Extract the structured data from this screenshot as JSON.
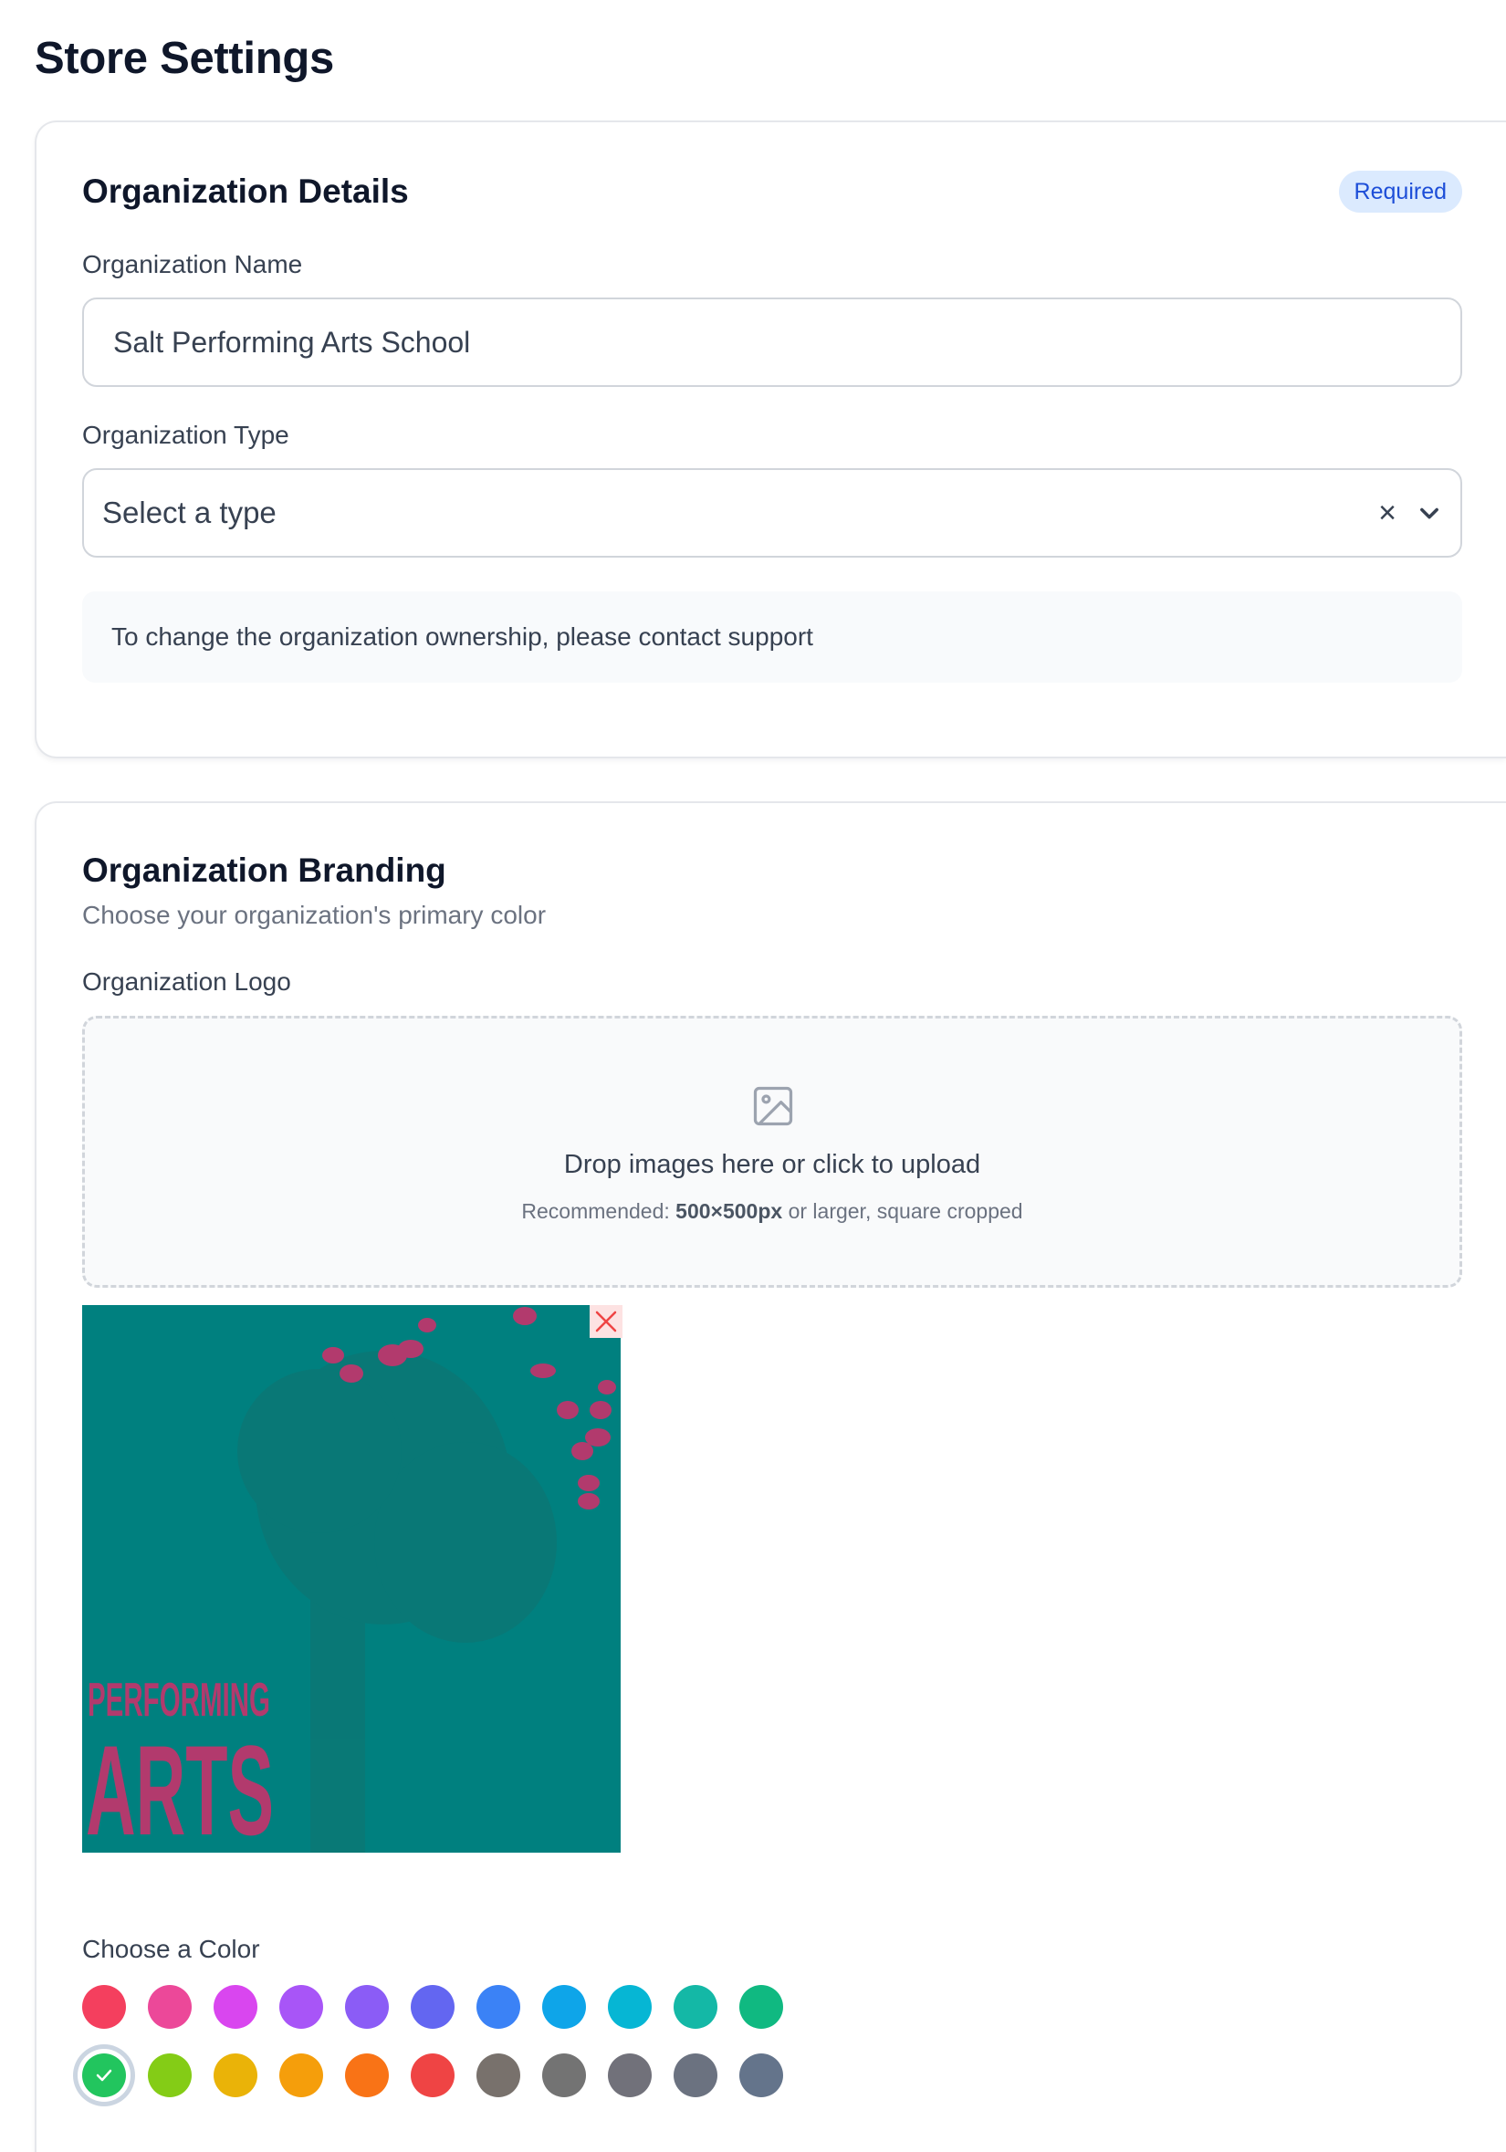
{
  "page": {
    "title": "Store Settings"
  },
  "details": {
    "title": "Organization Details",
    "badge": "Required",
    "name_label": "Organization Name",
    "name_value": "Salt Performing Arts School",
    "type_label": "Organization Type",
    "type_placeholder": "Select a type",
    "clear_glyph": "×",
    "ownership_note": "To change the organization ownership, please contact support"
  },
  "branding": {
    "title": "Organization Branding",
    "subtitle": "Choose your organization's primary color",
    "logo_label": "Organization Logo",
    "upload": {
      "main": "Drop images here or click to upload",
      "sub_prefix": "Recommended: ",
      "sub_bold": "500×500px",
      "sub_suffix": " or larger, square cropped"
    },
    "logo_image": {
      "icon": "uploaded-logo-image",
      "background": "#00807f",
      "accent": "#b23a6d",
      "text_line1": "PERFORMING",
      "text_line2": "ARTS"
    },
    "color_label": "Choose a Color",
    "colors_row1": [
      "#f43f5e",
      "#ec4899",
      "#d946ef",
      "#a855f7",
      "#8b5cf6",
      "#6366f1",
      "#3b82f6",
      "#0ea5e9",
      "#06b6d4",
      "#14b8a6",
      "#10b981"
    ],
    "colors_row2": [
      "#22c55e",
      "#84cc16",
      "#eab308",
      "#f59e0b",
      "#f97316",
      "#ef4444",
      "#78716c",
      "#737373",
      "#71717a",
      "#6b7280",
      "#64748b"
    ],
    "selected_color": "#22c55e"
  }
}
